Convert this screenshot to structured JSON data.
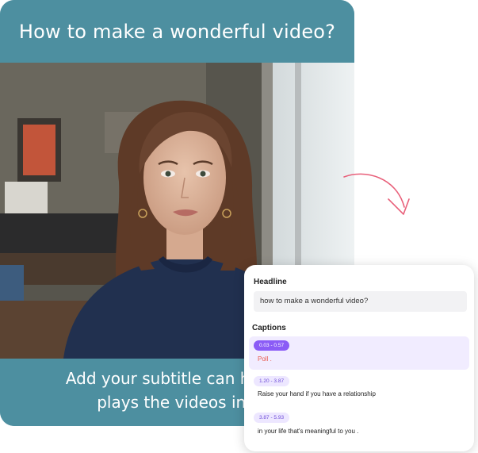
{
  "video": {
    "title": "How to make a wonderful video?",
    "subtitle_line1": "Add your subtitle can help y",
    "subtitle_line2": "plays the videos in r"
  },
  "editor": {
    "headline_label": "Headline",
    "headline_value": "how to make a wonderful video?",
    "captions_label": "Captions",
    "captions": [
      {
        "time": "0.03 - 0.57",
        "text": "Poll .",
        "active": true
      },
      {
        "time": "1.20 - 3.87",
        "text": "Raise your hand if you have a relationship",
        "active": false
      },
      {
        "time": "3.87 - 5.93",
        "text": "in your life that's meaningful to you .",
        "active": false
      }
    ]
  },
  "colors": {
    "brand_teal": "#4d8fa0",
    "accent_purple": "#8b5cf6",
    "arrow_pink": "#e8607a",
    "highlight_text": "#e85a4f"
  }
}
